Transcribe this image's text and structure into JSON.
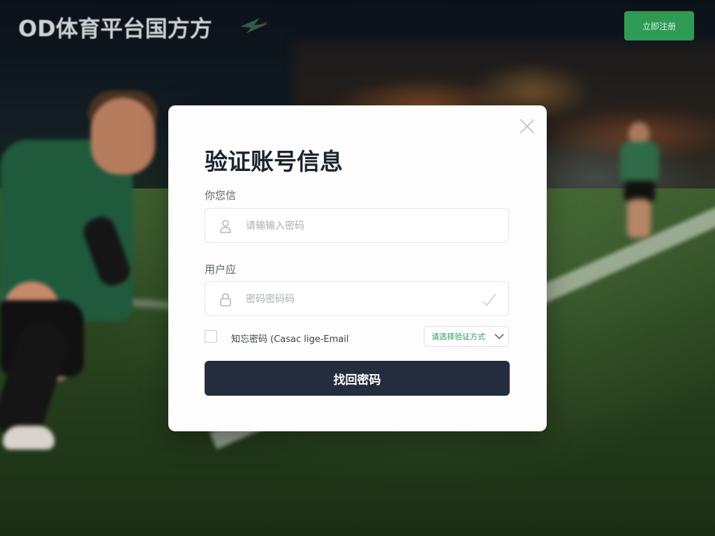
{
  "header": {
    "logo_text": "OD体育平台国方方",
    "tagline": "",
    "nav_links": "",
    "cta_label": "立即注册"
  },
  "modal": {
    "title": "验证账号信息",
    "field1": {
      "label": "你您信",
      "placeholder": "请输输入密码",
      "icon": "user-icon"
    },
    "field2": {
      "label": "用户应",
      "placeholder": "密码密码码",
      "icon": "lock-icon",
      "trailing_icon": "checkmark-icon"
    },
    "remember": {
      "label": "知忘密码 (Casac lige-Email",
      "checked": false
    },
    "method_select": {
      "value": "请选择验证方式"
    },
    "submit_label": "找回密码"
  },
  "colors": {
    "accent": "#2e9a56",
    "button": "#232d3d",
    "title": "#1c2430"
  }
}
